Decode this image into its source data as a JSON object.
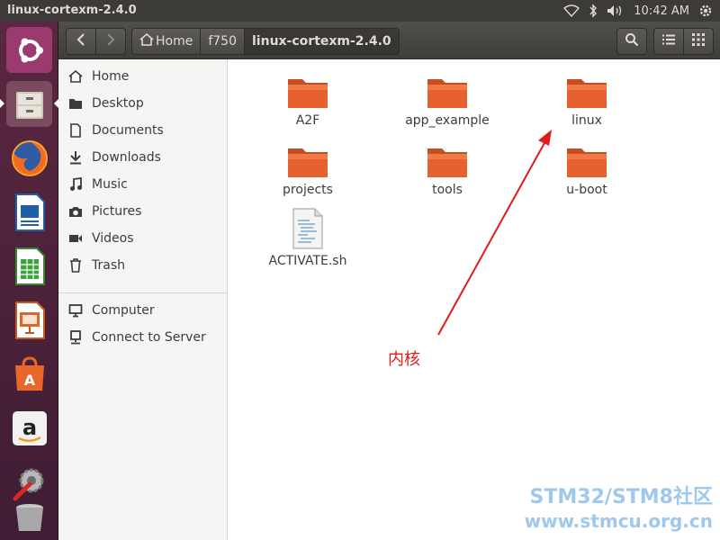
{
  "window_title": "linux-cortexm-2.4.0",
  "top_panel": {
    "clock": "10:42 AM"
  },
  "launcher": {
    "items": [
      "ubuntu-dash",
      "files",
      "firefox",
      "libreoffice-writer",
      "libreoffice-calc",
      "libreoffice-impress",
      "ubuntu-software",
      "amazon",
      "system-settings",
      "trash"
    ]
  },
  "breadcrumbs": [
    "Home",
    "f750",
    "linux-cortexm-2.4.0"
  ],
  "sidebar": {
    "places": [
      "Home",
      "Desktop",
      "Documents",
      "Downloads",
      "Music",
      "Pictures",
      "Videos",
      "Trash"
    ],
    "other": [
      "Computer",
      "Connect to Server"
    ]
  },
  "files": [
    {
      "name": "A2F",
      "type": "folder"
    },
    {
      "name": "app_example",
      "type": "folder"
    },
    {
      "name": "linux",
      "type": "folder"
    },
    {
      "name": "projects",
      "type": "folder"
    },
    {
      "name": "tools",
      "type": "folder"
    },
    {
      "name": "u-boot",
      "type": "folder"
    },
    {
      "name": "ACTIVATE.sh",
      "type": "script"
    }
  ],
  "annotation": {
    "text": "内核",
    "color": "#e11b1b"
  },
  "watermark": {
    "line1": "STM32/STM8社区",
    "line2": "www.stmcu.org.cn"
  },
  "colors": {
    "folder": "#e6612e",
    "launcher": "#4a2039",
    "accent_red": "#e11b1b"
  }
}
